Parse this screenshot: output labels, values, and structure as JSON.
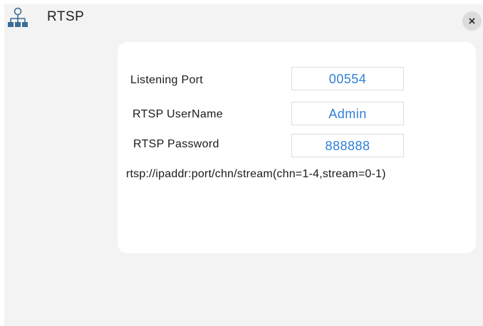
{
  "title_bar": {
    "title": "RTSP",
    "icon": "network-topology-icon",
    "close_label": "×"
  },
  "form": {
    "listening_port": {
      "label": "Listening Port",
      "value": "00554"
    },
    "username": {
      "label": "RTSP UserName",
      "value": "Admin"
    },
    "password": {
      "label": "RTSP Password",
      "value": "888888"
    },
    "url_hint": "rtsp://ipaddr:port/chn/stream(chn=1-4,stream=0-1)"
  },
  "colors": {
    "background": "#f3f3f3",
    "panel": "#ffffff",
    "value_text": "#2f7fd8",
    "icon": "#3a6c97"
  }
}
